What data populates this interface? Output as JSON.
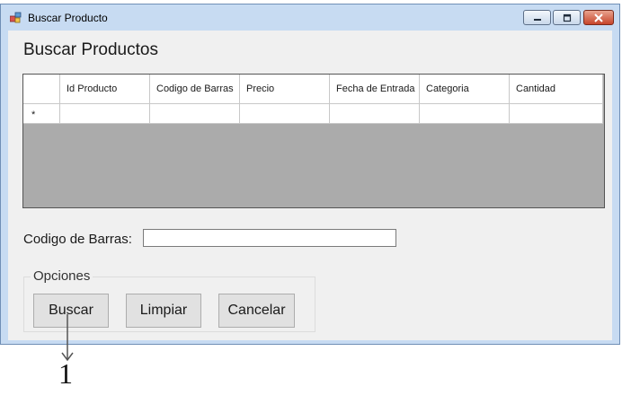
{
  "window": {
    "title": "Buscar Producto"
  },
  "form": {
    "heading": "Buscar Productos"
  },
  "grid": {
    "new_row_marker": "*",
    "columns": [
      "Id Producto",
      "Codigo de Barras",
      "Precio",
      "Fecha de Entrada",
      "Categoria",
      "Cantidad"
    ]
  },
  "search": {
    "label": "Codigo de Barras:",
    "value": ""
  },
  "options": {
    "label": "Opciones",
    "buttons": {
      "search": "Buscar",
      "clear": "Limpiar",
      "cancel": "Cancelar"
    }
  },
  "annotation": {
    "callout_number": "1"
  }
}
